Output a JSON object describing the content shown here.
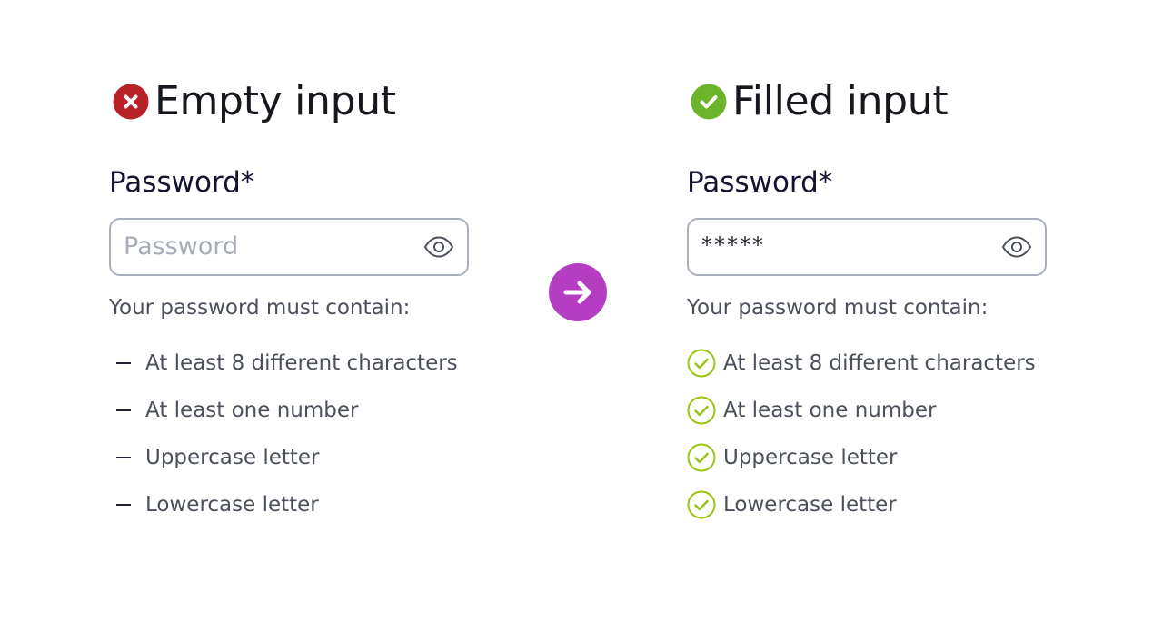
{
  "colors": {
    "error": "#b82127",
    "success": "#6cb52b",
    "check_outline": "#9ac416",
    "arrow_accent": "#b53dc2",
    "input_border": "#a9b0bc",
    "placeholder": "#a6adb9",
    "heading_text": "#16181d",
    "label_text": "#131230",
    "body_text": "#4b505a"
  },
  "empty_state": {
    "title": "Empty input",
    "status_icon": "error-x-icon",
    "field_label": "Password*",
    "input_placeholder": "Password",
    "input_value": "",
    "toggle_icon": "eye-icon",
    "requirements_intro": "Your password must contain:",
    "requirements": [
      {
        "label": "At least 8 different characters",
        "met": false
      },
      {
        "label": "At least one number",
        "met": false
      },
      {
        "label": "Uppercase letter",
        "met": false
      },
      {
        "label": "Lowercase letter",
        "met": false
      }
    ]
  },
  "transition": {
    "icon": "arrow-right-icon"
  },
  "filled_state": {
    "title": "Filled input",
    "status_icon": "success-check-icon",
    "field_label": "Password*",
    "input_value": "*****",
    "toggle_icon": "eye-icon",
    "requirements_intro": "Your password must contain:",
    "requirements": [
      {
        "label": "At least 8 different characters",
        "met": true
      },
      {
        "label": "At least one number",
        "met": true
      },
      {
        "label": "Uppercase letter",
        "met": true
      },
      {
        "label": "Lowercase letter",
        "met": true
      }
    ]
  }
}
